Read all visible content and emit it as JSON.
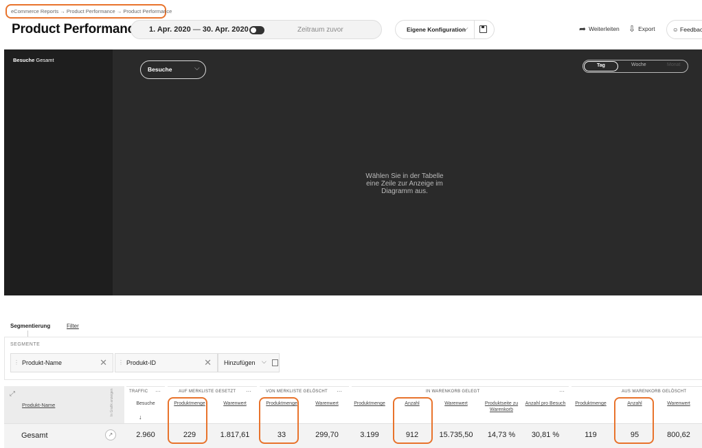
{
  "header": {
    "breadcrumb": "eCommerce Reports → Product Performance → Product Performance",
    "title": "Product Performance",
    "date_start": "1. Apr. 2020",
    "date_sep": "—",
    "date_end": "30. Apr. 2020",
    "compare_label": "Zeitraum zuvor",
    "config_label": "Eigene Konfiguration",
    "share_label": "Weiterleiten",
    "export_label": "Export",
    "feedback_label": "Feedback"
  },
  "chart": {
    "side_title_bold": "Besuche",
    "side_title_rest": "Gesamt",
    "metric": "Besuche",
    "periods": [
      "Tag",
      "Woche",
      "Monat"
    ],
    "empty_message": "Wählen Sie in der Tabelle eine Zeile zur Anzeige im Diagramm aus."
  },
  "segmentation": {
    "tab_segment": "Segmentierung",
    "tab_filter": "Filter",
    "label": "SEGMENTE",
    "chips": [
      "Produkt-Name",
      "Produkt-ID"
    ],
    "add_label": "Hinzufügen"
  },
  "table": {
    "name_header": "Produkt-Name",
    "rotated_label": "In Grafik anzeigen",
    "groups": [
      "TRAFFIC",
      "AUF MERKLISTE GESETZT",
      "VON MERKLISTE GELÖSCHT",
      "IN WARENKORB GELEGT",
      "AUS WARENKORB GELÖSCHT"
    ],
    "columns": [
      "Besuche",
      "Produktmenge",
      "Warenwert",
      "Produktmenge",
      "Warenwert",
      "Produktmenge",
      "Anzahl",
      "Warenwert",
      "Produktseite zu Warenkorb",
      "Anzahl pro Besuch",
      "Produktmenge",
      "Anzahl",
      "Warenwert"
    ],
    "total_label": "Gesamt",
    "totals": [
      "2.960",
      "229",
      "1.817,61",
      "33",
      "299,70",
      "3.199",
      "912",
      "15.735,50",
      "14,73 %",
      "30,81 %",
      "119",
      "95",
      "800,62"
    ]
  },
  "colors": {
    "highlight": "#e8722a",
    "chart_bg": "#2a2a2a"
  }
}
